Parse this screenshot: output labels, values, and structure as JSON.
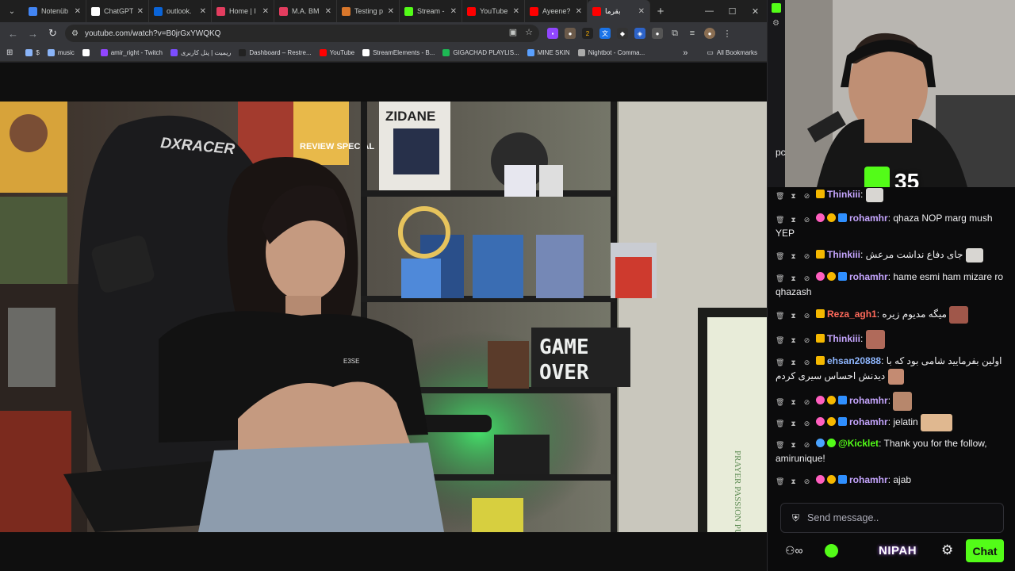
{
  "tabs": [
    {
      "title": "Notenüb",
      "color": "#4285f4"
    },
    {
      "title": "ChatGPT",
      "color": "#ffffff"
    },
    {
      "title": "outlook.",
      "color": "#0a64d8"
    },
    {
      "title": "Home | I",
      "color": "#e33d5f"
    },
    {
      "title": "M.A. BM",
      "color": "#e33d5f"
    },
    {
      "title": "Testing p",
      "color": "#d9772b"
    },
    {
      "title": "Stream -",
      "color": "#53fc18"
    },
    {
      "title": "YouTube",
      "color": "#ff0000"
    },
    {
      "title": "Ayeene?",
      "color": "#ff0000"
    },
    {
      "title": "بقرما",
      "color": "#ff0000",
      "active": true
    }
  ],
  "address_bar": {
    "url": "youtube.com/watch?v=B0jrGxYWQKQ"
  },
  "bookmarks": [
    {
      "label": "$",
      "color": "#8ab4f8"
    },
    {
      "label": "music",
      "color": "#8ab4f8"
    },
    {
      "label": "",
      "color": "#ffffff"
    },
    {
      "label": "amir_right - Twitch",
      "color": "#9146ff"
    },
    {
      "label": "ریمیت | پنل کاربری",
      "color": "#7b4dff"
    },
    {
      "label": "Dashboard – Restre...",
      "color": "#222222"
    },
    {
      "label": "YouTube",
      "color": "#ff0000"
    },
    {
      "label": "StreamElements - B...",
      "color": "#ffffff"
    },
    {
      "label": "GIGACHAD PLAYLIS...",
      "color": "#1db954"
    },
    {
      "label": "MINE SKIN",
      "color": "#5aa0ff"
    },
    {
      "label": "Nightbot - Comma...",
      "color": "#aaaaaa"
    }
  ],
  "bookmarks_overflow": "»",
  "all_bookmarks": "All Bookmarks",
  "video": {
    "chair_brand": "DXRACER",
    "poster_top": "ZIDANE",
    "poster_review": "REVIEW SPECIAL",
    "sign_line1": "GAME",
    "sign_line2": "OVER",
    "wall_art": "PRAYER PASSION PURPOSE",
    "shirt": "E3SE"
  },
  "cam": {
    "kick_count": "35"
  },
  "chat": {
    "messages": [
      {
        "user": "Thinkiii",
        "color": "#c6a6ff",
        "text": "",
        "emote": "cat"
      },
      {
        "user": "rohamhr",
        "color": "#c6a6ff",
        "text": "qhaza NOP marg mush YEP"
      },
      {
        "user": "Thinkiii",
        "color": "#c6a6ff",
        "text": "جای دفاع نداشت مرعش",
        "emote": "cat"
      },
      {
        "user": "rohamhr",
        "color": "#c6a6ff",
        "text": "hame esmi ham mizare ro qhazash"
      },
      {
        "user": "Reza_agh1",
        "color": "#ff6a5b",
        "text": "میگه مدیوم زیره",
        "emote": "face"
      },
      {
        "user": "Thinkiii",
        "color": "#c6a6ff",
        "text": "",
        "emote": "face2"
      },
      {
        "user": "ehsan20888",
        "color": "#8fb7ff",
        "text": "اولین بفرمایید شامی بود که با دیدنش احساس سیری کردم",
        "emote": "face3"
      },
      {
        "user": "rohamhr",
        "color": "#c6a6ff",
        "text": "",
        "emote": "face4"
      },
      {
        "user": "rohamhr",
        "color": "#c6a6ff",
        "text": "jelatin",
        "emote": "cat2"
      },
      {
        "user": "@Kicklet",
        "color": "#53fc18",
        "text": "Thank you for the follow, amirunique!"
      },
      {
        "user": "rohamhr",
        "color": "#c6a6ff",
        "text": "ajab"
      }
    ],
    "partial_text": "pc",
    "input_placeholder": "Send message..",
    "send_label": "Chat",
    "brand": "NIPAH"
  }
}
